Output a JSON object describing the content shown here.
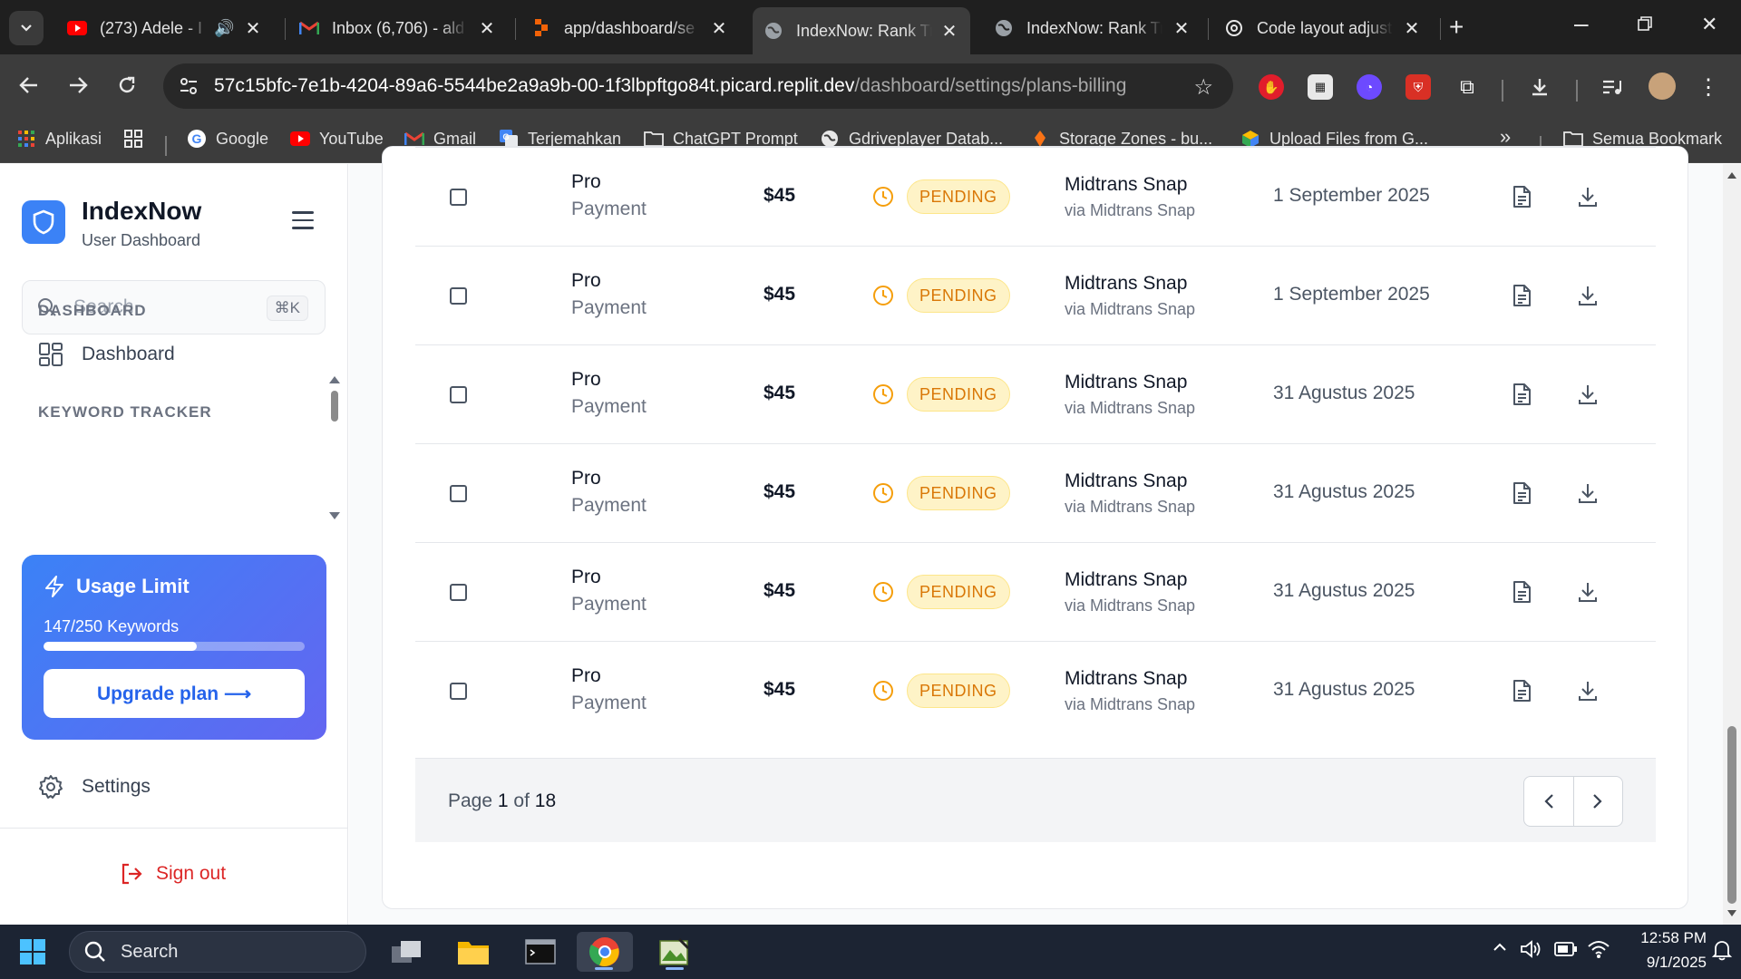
{
  "browser": {
    "tabs": [
      {
        "title": "(273) Adele - I",
        "icon": "youtube-icon"
      },
      {
        "title": "Inbox (6,706) - ald",
        "icon": "gmail-icon"
      },
      {
        "title": "app/dashboard/se",
        "icon": "replit-icon"
      },
      {
        "title": "IndexNow: Rank Tr",
        "icon": "globe-icon",
        "active": true
      },
      {
        "title": "IndexNow: Rank Tr",
        "icon": "globe-icon"
      },
      {
        "title": "Code layout adjust",
        "icon": "openai-icon"
      }
    ],
    "url_host": "57c15bfc-7e1b-4204-89a6-5544be2a9a9b-00-1f3lbpftgo84t.picard.replit.dev",
    "url_path": "/dashboard/settings/plans-billing",
    "bookmarks": [
      {
        "label": "Aplikasi",
        "icon": "apps-grid-icon"
      },
      {
        "label": "",
        "icon": "grid-icon"
      },
      {
        "label": "Google",
        "icon": "google-icon"
      },
      {
        "label": "YouTube",
        "icon": "youtube-icon"
      },
      {
        "label": "Gmail",
        "icon": "gmail-icon"
      },
      {
        "label": "Terjemahkan",
        "icon": "translate-icon"
      },
      {
        "label": "ChatGPT Prompt",
        "icon": "folder-icon"
      },
      {
        "label": "Gdriveplayer Datab...",
        "icon": "globe-icon"
      },
      {
        "label": "Storage Zones - bu...",
        "icon": "bunny-icon"
      },
      {
        "label": "Upload Files from G...",
        "icon": "cube-icon"
      }
    ],
    "bookmarks_more": "»",
    "all_bookmarks": "Semua Bookmark"
  },
  "sidebar": {
    "brand": "IndexNow",
    "brand_sub": "User Dashboard",
    "search_placeholder": "Search",
    "search_shortcut": "⌘K",
    "section_dashboard": "DASHBOARD",
    "nav_dashboard": "Dashboard",
    "section_keyword": "KEYWORD TRACKER",
    "usage_title": "Usage Limit",
    "usage_count": "147/250 Keywords",
    "usage_fraction": 0.588,
    "upgrade_label": "Upgrade plan ⟶",
    "settings_label": "Settings",
    "signout_label": "Sign out"
  },
  "billing": {
    "rows": [
      {
        "plan": "Pro",
        "type": "Payment",
        "amount": "$45",
        "status": "PENDING",
        "method": "Midtrans Snap",
        "via": "via Midtrans Snap",
        "date": "1 September 2025"
      },
      {
        "plan": "Pro",
        "type": "Payment",
        "amount": "$45",
        "status": "PENDING",
        "method": "Midtrans Snap",
        "via": "via Midtrans Snap",
        "date": "1 September 2025"
      },
      {
        "plan": "Pro",
        "type": "Payment",
        "amount": "$45",
        "status": "PENDING",
        "method": "Midtrans Snap",
        "via": "via Midtrans Snap",
        "date": "31 Agustus 2025"
      },
      {
        "plan": "Pro",
        "type": "Payment",
        "amount": "$45",
        "status": "PENDING",
        "method": "Midtrans Snap",
        "via": "via Midtrans Snap",
        "date": "31 Agustus 2025"
      },
      {
        "plan": "Pro",
        "type": "Payment",
        "amount": "$45",
        "status": "PENDING",
        "method": "Midtrans Snap",
        "via": "via Midtrans Snap",
        "date": "31 Agustus 2025"
      },
      {
        "plan": "Pro",
        "type": "Payment",
        "amount": "$45",
        "status": "PENDING",
        "method": "Midtrans Snap",
        "via": "via Midtrans Snap",
        "date": "31 Agustus 2025"
      }
    ],
    "page_prefix": "Page ",
    "page_current": "1",
    "page_of": " of ",
    "page_total": "18"
  },
  "taskbar": {
    "search_placeholder": "Search",
    "time": "12:58 PM",
    "date": "9/1/2025"
  },
  "colors": {
    "accent": "#3b82f6",
    "pending_text": "#d97706",
    "pending_bg": "#fef3c7",
    "signout": "#dc2626"
  }
}
